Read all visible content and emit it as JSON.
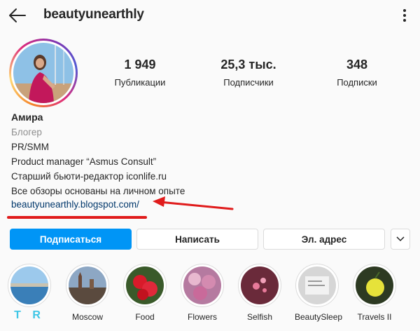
{
  "header": {
    "username": "beautyunearthly"
  },
  "stats": [
    {
      "value": "1 949",
      "label": "Публикации"
    },
    {
      "value": "25,3 тыс.",
      "label": "Подписчики"
    },
    {
      "value": "348",
      "label": "Подписки"
    }
  ],
  "bio": {
    "name": "Амира",
    "category": "Блогер",
    "lines": [
      "PR/SMM",
      "Product manager “Asmus Consult”",
      "Старший бьюти-редактор iconlife.ru",
      "Все обзоры основаны на личном опыте"
    ],
    "link": "beautyunearthly.blogspot.com/"
  },
  "buttons": {
    "follow": "Подписаться",
    "message": "Написать",
    "email": "Эл. адрес"
  },
  "highlights": [
    {
      "label": "T R",
      "icon": "sea-city-photo"
    },
    {
      "label": "Moscow",
      "icon": "city-photo"
    },
    {
      "label": "Food",
      "icon": "strawberry-photo"
    },
    {
      "label": "Flowers",
      "icon": "flowers-photo"
    },
    {
      "label": "Selfish",
      "icon": "hearts-photo"
    },
    {
      "label": "BeautySleep",
      "icon": "paper-photo"
    },
    {
      "label": "Travels II",
      "icon": "lemon-photo"
    }
  ],
  "colors": {
    "accent": "#0095f6",
    "annotation": "#e01b1b",
    "link": "#00376b"
  }
}
